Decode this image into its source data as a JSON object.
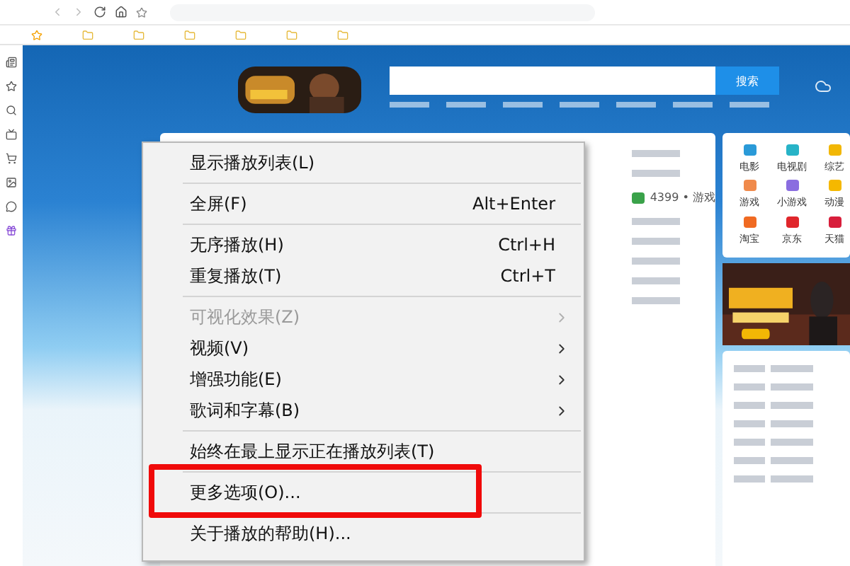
{
  "search": {
    "button": "搜索"
  },
  "shortcuts": [
    {
      "label": "电影",
      "color": "#2a9ad8"
    },
    {
      "label": "电视剧",
      "color": "#27b3c7"
    },
    {
      "label": "综艺",
      "color": "#f2b705"
    },
    {
      "label": "游戏",
      "color": "#f08a4b"
    },
    {
      "label": "小游戏",
      "color": "#8a6de0"
    },
    {
      "label": "动漫",
      "color": "#f5b800"
    },
    {
      "label": "淘宝",
      "color": "#f06a22"
    },
    {
      "label": "京东",
      "color": "#e0262b"
    },
    {
      "label": "天猫",
      "color": "#d81e3b"
    }
  ],
  "links": [
    {
      "label": "4399 • 游戏"
    }
  ],
  "menu": [
    {
      "kind": "item",
      "label": "显示播放列表(L)",
      "disabled": false,
      "submenu": false,
      "highlighted": false
    },
    {
      "kind": "separator"
    },
    {
      "kind": "item",
      "label": "全屏(F)",
      "shortcut": "Alt+Enter",
      "disabled": false,
      "submenu": false,
      "highlighted": false
    },
    {
      "kind": "separator"
    },
    {
      "kind": "item",
      "label": "无序播放(H)",
      "shortcut": "Ctrl+H",
      "disabled": false,
      "submenu": false,
      "highlighted": false
    },
    {
      "kind": "item",
      "label": "重复播放(T)",
      "shortcut": "Ctrl+T",
      "disabled": false,
      "submenu": false,
      "highlighted": false
    },
    {
      "kind": "separator"
    },
    {
      "kind": "item",
      "label": "可视化效果(Z)",
      "disabled": true,
      "submenu": true,
      "highlighted": false
    },
    {
      "kind": "item",
      "label": "视频(V)",
      "disabled": false,
      "submenu": true,
      "highlighted": false
    },
    {
      "kind": "item",
      "label": "增强功能(E)",
      "disabled": false,
      "submenu": true,
      "highlighted": false
    },
    {
      "kind": "item",
      "label": "歌词和字幕(B)",
      "disabled": false,
      "submenu": true,
      "highlighted": false
    },
    {
      "kind": "separator"
    },
    {
      "kind": "item",
      "label": "始终在最上显示正在播放列表(T)",
      "disabled": false,
      "submenu": false,
      "highlighted": false
    },
    {
      "kind": "separator"
    },
    {
      "kind": "item",
      "label": "更多选项(O)...",
      "disabled": false,
      "submenu": false,
      "highlighted": true
    },
    {
      "kind": "separator"
    },
    {
      "kind": "item",
      "label": "关于播放的帮助(H)...",
      "disabled": false,
      "submenu": false,
      "highlighted": false
    }
  ]
}
